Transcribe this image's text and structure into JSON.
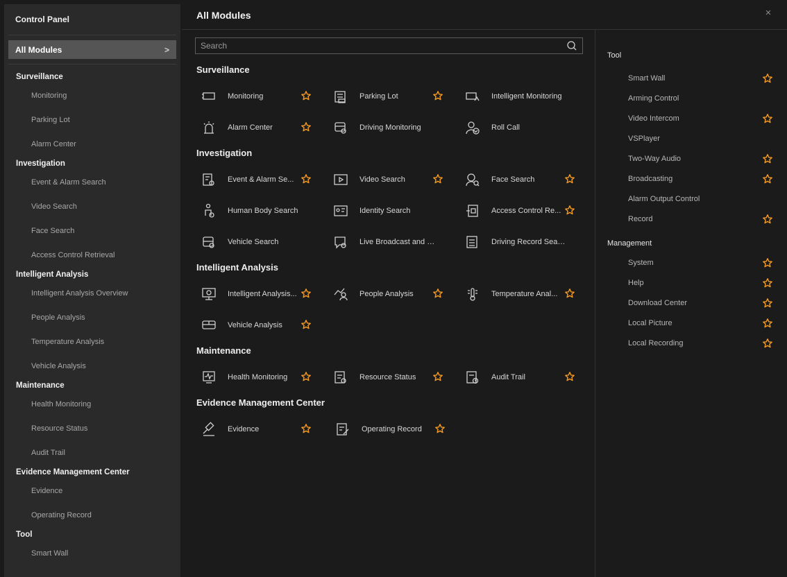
{
  "sidebar": {
    "title": "Control Panel",
    "all_modules": "All Modules",
    "chevron": ">",
    "groups": [
      {
        "title": "Surveillance",
        "items": [
          "Monitoring",
          "Parking Lot",
          "Alarm Center"
        ]
      },
      {
        "title": "Investigation",
        "items": [
          "Event & Alarm Search",
          "Video Search",
          "Face Search",
          "Access Control Retrieval"
        ]
      },
      {
        "title": "Intelligent Analysis",
        "items": [
          "Intelligent Analysis Overview",
          "People Analysis",
          "Temperature Analysis",
          "Vehicle Analysis"
        ]
      },
      {
        "title": "Maintenance",
        "items": [
          "Health Monitoring",
          "Resource Status",
          "Audit Trail"
        ]
      },
      {
        "title": "Evidence Management Center",
        "items": [
          "Evidence",
          "Operating Record"
        ]
      },
      {
        "title": "Tool",
        "items": [
          "Smart Wall"
        ]
      }
    ]
  },
  "main": {
    "title": "All Modules",
    "close": "×",
    "search_placeholder": "Search",
    "categories": [
      {
        "title": "Surveillance",
        "rows": [
          [
            {
              "label": "Monitoring",
              "icon": "monitor-icon",
              "star": true
            },
            {
              "label": "Parking Lot",
              "icon": "parking-icon",
              "star": true
            },
            {
              "label": "Intelligent Monitoring",
              "icon": "intelligent-monitor-icon",
              "star": false
            }
          ],
          [
            {
              "label": "Alarm Center",
              "icon": "alarm-icon",
              "star": true
            },
            {
              "label": "Driving Monitoring",
              "icon": "driving-monitor-icon",
              "star": false
            },
            {
              "label": "Roll Call",
              "icon": "roll-call-icon",
              "star": false
            }
          ]
        ]
      },
      {
        "title": "Investigation",
        "rows": [
          [
            {
              "label": "Event & Alarm Se...",
              "icon": "event-search-icon",
              "star": true
            },
            {
              "label": "Video Search",
              "icon": "video-search-icon",
              "star": true
            },
            {
              "label": "Face Search",
              "icon": "face-search-icon",
              "star": true
            }
          ],
          [
            {
              "label": "Human Body Search",
              "icon": "human-body-icon",
              "star": false
            },
            {
              "label": "Identity Search",
              "icon": "identity-icon",
              "star": false
            },
            {
              "label": "Access Control Re...",
              "icon": "access-control-icon",
              "star": true
            }
          ],
          [
            {
              "label": "Vehicle Search",
              "icon": "vehicle-search-icon",
              "star": false
            },
            {
              "label": "Live Broadcast and R...",
              "icon": "broadcast-icon",
              "star": false
            },
            {
              "label": "Driving Record Search",
              "icon": "driving-record-icon",
              "star": false
            }
          ]
        ]
      },
      {
        "title": "Intelligent Analysis",
        "rows": [
          [
            {
              "label": "Intelligent Analysis...",
              "icon": "analysis-overview-icon",
              "star": true
            },
            {
              "label": "People Analysis",
              "icon": "people-analysis-icon",
              "star": true
            },
            {
              "label": "Temperature Anal...",
              "icon": "temperature-icon",
              "star": true
            }
          ],
          [
            {
              "label": "Vehicle Analysis",
              "icon": "vehicle-analysis-icon",
              "star": true
            }
          ]
        ]
      },
      {
        "title": "Maintenance",
        "rows": [
          [
            {
              "label": "Health Monitoring",
              "icon": "health-icon",
              "star": true
            },
            {
              "label": "Resource Status",
              "icon": "resource-icon",
              "star": true
            },
            {
              "label": "Audit Trail",
              "icon": "audit-icon",
              "star": true
            }
          ]
        ]
      },
      {
        "title": "Evidence Management Center",
        "rows": [
          [
            {
              "label": "Evidence",
              "icon": "gavel-icon",
              "star": true
            },
            {
              "label": "Operating Record",
              "icon": "operating-record-icon",
              "star": true
            }
          ]
        ]
      }
    ]
  },
  "right_panel": {
    "groups": [
      {
        "title": "Tool",
        "items": [
          {
            "label": "Smart Wall",
            "star": true
          },
          {
            "label": "Arming Control",
            "star": false
          },
          {
            "label": "Video Intercom",
            "star": true
          },
          {
            "label": "VSPlayer",
            "star": false
          },
          {
            "label": "Two-Way Audio",
            "star": true
          },
          {
            "label": "Broadcasting",
            "star": true
          },
          {
            "label": "Alarm Output Control",
            "star": false
          },
          {
            "label": "Record",
            "star": true
          }
        ]
      },
      {
        "title": "Management",
        "items": [
          {
            "label": "System",
            "star": true
          },
          {
            "label": "Help",
            "star": true
          },
          {
            "label": "Download Center",
            "star": true
          },
          {
            "label": "Local Picture",
            "star": true
          },
          {
            "label": "Local Recording",
            "star": true
          }
        ]
      }
    ]
  },
  "colors": {
    "accent_star": "#f59a23",
    "selected_bg": "#555555",
    "sidebar_bg": "#2a2a2a",
    "page_bg": "#1b1b1b"
  }
}
